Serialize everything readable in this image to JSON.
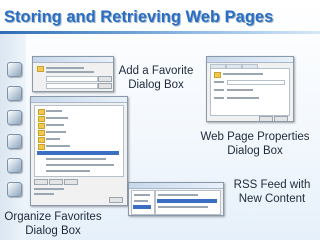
{
  "slide": {
    "title": "Storing and Retrieving Web Pages",
    "captions": {
      "add_favorite": [
        "Add a Favorite",
        "Dialog Box"
      ],
      "web_page_properties": [
        "Web Page Properties",
        "Dialog Box"
      ],
      "rss_feed": [
        "RSS Feed with",
        "New Content"
      ],
      "organize_favorites": [
        "Organize Favorites",
        "Dialog Box"
      ]
    },
    "colors": {
      "title": "#2a6ec3",
      "accent_rule": "#2d6db5"
    }
  }
}
